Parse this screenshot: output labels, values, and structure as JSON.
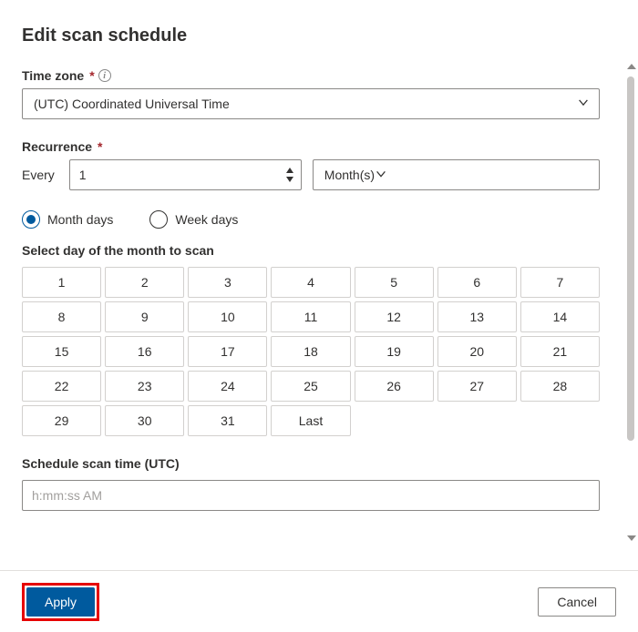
{
  "title": "Edit scan schedule",
  "timezone": {
    "label": "Time zone",
    "value": "(UTC) Coordinated Universal Time"
  },
  "recurrence": {
    "label": "Recurrence",
    "every_label": "Every",
    "every_value": "1",
    "unit": "Month(s)"
  },
  "mode": {
    "month_days": "Month days",
    "week_days": "Week days"
  },
  "day_select": {
    "label": "Select day of the month to scan",
    "days": [
      "1",
      "2",
      "3",
      "4",
      "5",
      "6",
      "7",
      "8",
      "9",
      "10",
      "11",
      "12",
      "13",
      "14",
      "15",
      "16",
      "17",
      "18",
      "19",
      "20",
      "21",
      "22",
      "23",
      "24",
      "25",
      "26",
      "27",
      "28",
      "29",
      "30",
      "31",
      "Last"
    ]
  },
  "scan_time": {
    "label": "Schedule scan time (UTC)",
    "placeholder": "h:mm:ss AM"
  },
  "footer": {
    "apply": "Apply",
    "cancel": "Cancel"
  }
}
